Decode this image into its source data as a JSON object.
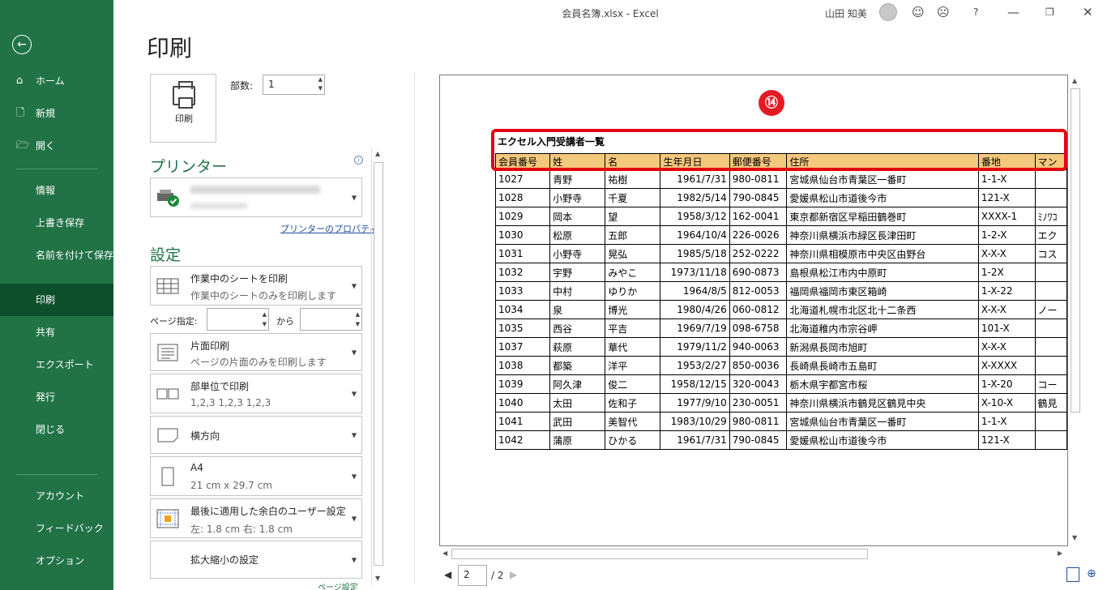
{
  "window": {
    "title": "会員名簿.xlsx  -  Excel",
    "user": "山田 知美",
    "help": "?"
  },
  "nav": {
    "home": "ホーム",
    "new": "新規",
    "open": "開く",
    "info": "情報",
    "save": "上書き保存",
    "save_as": "名前を付けて保存",
    "print": "印刷",
    "share": "共有",
    "export": "エクスポート",
    "publish": "発行",
    "close": "閉じる",
    "account": "アカウント",
    "feedback": "フィードバック",
    "options": "オプション"
  },
  "print": {
    "heading": "印刷",
    "button_label": "印刷",
    "copies_label": "部数:",
    "copies_value": "1",
    "printer_section": "プリンター",
    "printer_props": "プリンターのプロパティ",
    "settings_section": "設定",
    "pages_label": "ページ指定:",
    "to_label": "から",
    "settings_more": "ページ設定"
  },
  "settings": [
    {
      "title": "作業中のシートを印刷",
      "sub": "作業中のシートのみを印刷します"
    },
    {
      "title": "片面印刷",
      "sub": "ページの片面のみを印刷します"
    },
    {
      "title": "部単位で印刷",
      "sub": "1,2,3    1,2,3    1,2,3"
    },
    {
      "title": "横方向",
      "sub": ""
    },
    {
      "title": "A4",
      "sub": "21 cm x 29.7 cm"
    },
    {
      "title": "最後に適用した余白のユーザー設定",
      "sub": "左:  1.8 cm    右:  1.8 cm"
    },
    {
      "title": "拡大縮小の設定",
      "sub": ""
    }
  ],
  "preview": {
    "badge": "⑭",
    "sheet_title": "エクセル入門受講者一覧",
    "headers": [
      "会員番号",
      "姓",
      "名",
      "生年月日",
      "郵便番号",
      "住所",
      "番地",
      "マン"
    ],
    "rows": [
      [
        "1027",
        "青野",
        "祐樹",
        "1961/7/31",
        "980-0811",
        "宮城県仙台市青葉区一番町",
        "1-1-X",
        ""
      ],
      [
        "1028",
        "小野寺",
        "千夏",
        "1982/5/14",
        "790-0845",
        "愛媛県松山市道後今市",
        "121-X",
        ""
      ],
      [
        "1029",
        "岡本",
        "望",
        "1958/3/12",
        "162-0041",
        "東京都新宿区早稲田鶴巻町",
        "XXXX-1",
        "ﾐﾉﾜｺ"
      ],
      [
        "1030",
        "松原",
        "五郎",
        "1964/10/4",
        "226-0026",
        "神奈川県横浜市緑区長津田町",
        "1-2-X",
        "エク"
      ],
      [
        "1031",
        "小野寺",
        "晃弘",
        "1985/5/18",
        "252-0222",
        "神奈川県相模原市中央区由野台",
        "X-X-X",
        "コス"
      ],
      [
        "1032",
        "宇野",
        "みやこ",
        "1973/11/18",
        "690-0873",
        "島根県松江市内中原町",
        "1-2X",
        ""
      ],
      [
        "1033",
        "中村",
        "ゆりか",
        "1964/8/5",
        "812-0053",
        "福岡県福岡市東区箱崎",
        "1-X-22",
        ""
      ],
      [
        "1034",
        "泉",
        "博光",
        "1980/4/26",
        "060-0812",
        "北海道札幌市北区北十二条西",
        "X-X-X",
        "ノー"
      ],
      [
        "1035",
        "西谷",
        "平吉",
        "1969/7/19",
        "098-6758",
        "北海道稚内市宗谷岬",
        "101-X",
        ""
      ],
      [
        "1037",
        "萩原",
        "華代",
        "1979/11/2",
        "940-0063",
        "新潟県長岡市旭町",
        "X-X-X",
        ""
      ],
      [
        "1038",
        "都築",
        "洋平",
        "1953/2/27",
        "850-0036",
        "長崎県長崎市五島町",
        "X-XXXX",
        ""
      ],
      [
        "1039",
        "阿久津",
        "俊二",
        "1958/12/15",
        "320-0043",
        "栃木県宇都宮市桜",
        "1-X-20",
        "コー"
      ],
      [
        "1040",
        "太田",
        "佐和子",
        "1977/9/10",
        "230-0051",
        "神奈川県横浜市鶴見区鶴見中央",
        "X-10-X",
        "鶴見"
      ],
      [
        "1041",
        "武田",
        "美智代",
        "1983/10/29",
        "980-0811",
        "宮城県仙台市青葉区一番町",
        "1-1-X",
        ""
      ],
      [
        "1042",
        "蒲原",
        "ひかる",
        "1961/7/31",
        "790-0845",
        "愛媛県松山市道後今市",
        "121-X",
        ""
      ]
    ]
  },
  "pager": {
    "current": "2",
    "total": "/ 2"
  },
  "colors": {
    "accent": "#217346",
    "header_fill": "#f4c87d",
    "highlight": "#e4000f"
  }
}
